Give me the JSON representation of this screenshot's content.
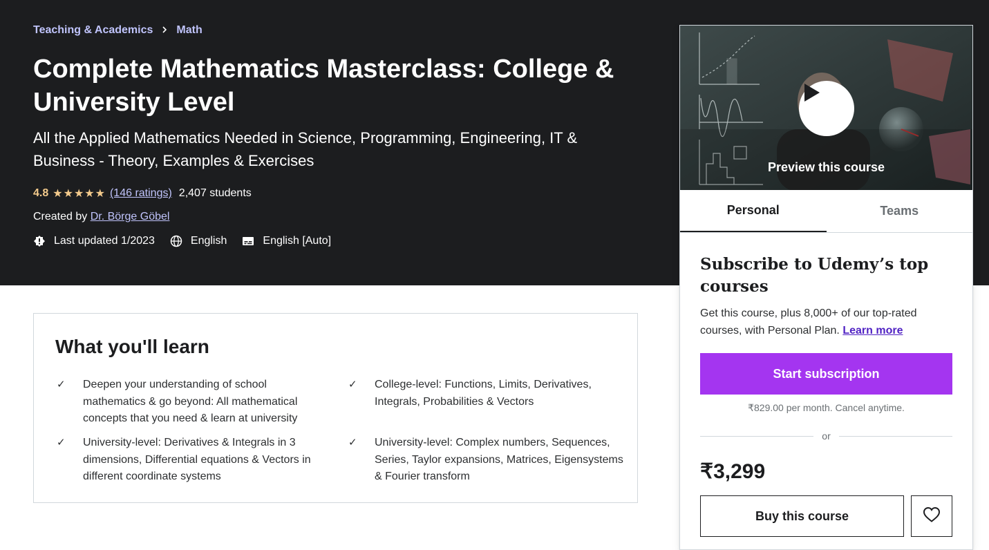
{
  "breadcrumb": {
    "items": [
      "Teaching & Academics",
      "Math"
    ]
  },
  "course": {
    "title": "Complete Mathematics Masterclass: College & University Level",
    "subtitle": "All the Applied Mathematics Needed in Science, Programming, Engineering, IT & Business - Theory, Examples & Exercises",
    "rating": "4.8",
    "stars": "★★★★★",
    "ratings_count": "(146 ratings)",
    "students": "2,407 students",
    "created_by_label": "Created by",
    "author": "Dr. Börge Göbel",
    "last_updated": "Last updated 1/2023",
    "language": "English",
    "captions": "English [Auto]"
  },
  "learn": {
    "heading": "What you'll learn",
    "items": [
      "Deepen your understanding of school mathematics & go beyond: All mathematical concepts that you need & learn at university",
      "College-level: Functions, Limits, Derivatives, Integrals, Probabilities & Vectors",
      "University-level: Derivatives & Integrals in 3 dimensions, Differential equations & Vectors in different coordinate systems",
      "University-level: Complex numbers, Sequences, Series, Taylor expansions, Matrices, Eigensystems & Fourier transform"
    ]
  },
  "card": {
    "preview_label": "Preview this course",
    "tabs": [
      "Personal",
      "Teams"
    ],
    "subscribe_title": "Subscribe to Udemy’s top courses",
    "subscribe_desc": "Get this course, plus 8,000+ of our top-rated courses, with Personal Plan.",
    "learn_more": "Learn more",
    "start_subscription": "Start subscription",
    "per_month": "₹829.00 per month. Cancel anytime.",
    "or": "or",
    "price": "₹3,299",
    "buy": "Buy this course"
  },
  "colors": {
    "hero_bg": "#1c1d1f",
    "accent": "#a435f0",
    "link": "#c0c4fc",
    "star": "#f3ca8c"
  },
  "icons": {
    "breadcrumb_sep": "chevron-right-icon",
    "updated": "alert-badge-icon",
    "language": "globe-icon",
    "captions": "closed-captions-icon",
    "check": "check-icon",
    "play": "play-icon",
    "wishlist": "heart-icon"
  }
}
